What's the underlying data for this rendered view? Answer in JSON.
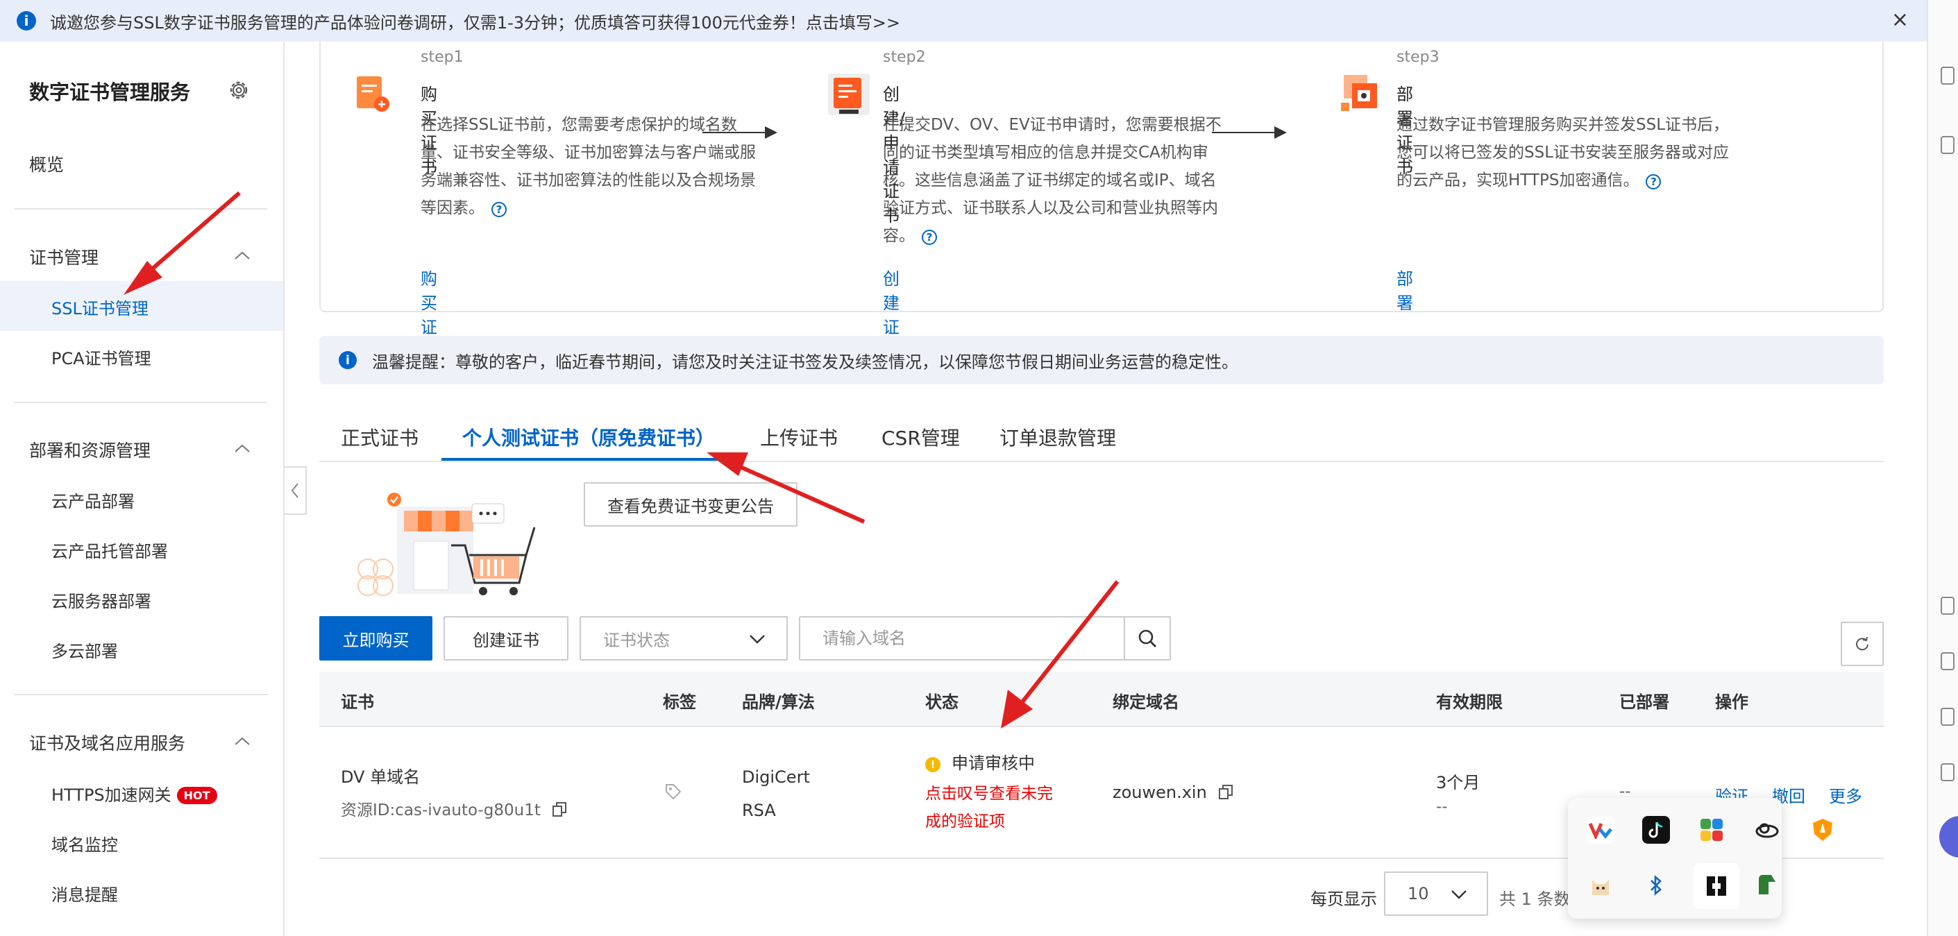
{
  "banner": {
    "text": "诚邀您参与SSL数字证书服务管理的产品体验问卷调研，仅需1-3分钟；优质填答可获得100元代金券！点击填写>>",
    "close": "×"
  },
  "sidebar": {
    "title": "数字证书管理服务",
    "overview": "概览",
    "groups": [
      {
        "label": "证书管理",
        "items": [
          "SSL证书管理",
          "PCA证书管理"
        ]
      },
      {
        "label": "部署和资源管理",
        "items": [
          "云产品部署",
          "云产品托管部署",
          "云服务器部署",
          "多云部署"
        ]
      },
      {
        "label": "证书及域名应用服务",
        "items": [
          "HTTPS加速网关",
          "域名监控",
          "消息提醒"
        ]
      }
    ],
    "hot_badge": "HOT"
  },
  "steps": [
    {
      "label": "step1",
      "title": "购买证书",
      "desc": "在选择SSL证书前，您需要考虑保护的域名数量、证书安全等级、证书加密算法与客户端或服务端兼容性、证书加密算法的性能以及合规场景等因素。",
      "link": "购买证书"
    },
    {
      "label": "step2",
      "title": "创建/申请证书",
      "desc": "在提交DV、OV、EV证书申请时，您需要根据不同的证书类型填写相应的信息并提交CA机构审核。这些信息涵盖了证书绑定的域名或IP、域名验证方式、证书联系人以及公司和营业执照等内容。",
      "link": "创建证书"
    },
    {
      "label": "step3",
      "title": "部署证书",
      "desc": "通过数字证书管理服务购买并签发SSL证书后，您可以将已签发的SSL证书安装至服务器或对应的云产品，实现HTTPS加密通信。",
      "link": "部署"
    }
  ],
  "notice": {
    "text": "温馨提醒：尊敬的客户，临近春节期间，请您及时关注证书签发及续签情况，以保障您节假日期间业务运营的稳定性。"
  },
  "tabs": [
    "正式证书",
    "个人测试证书（原免费证书）",
    "上传证书",
    "CSR管理",
    "订单退款管理"
  ],
  "active_tab": 1,
  "notice_button": "查看免费证书变更公告",
  "toolbar": {
    "buy": "立即购买",
    "create": "创建证书",
    "status_placeholder": "证书状态",
    "search_placeholder": "请输入域名"
  },
  "table": {
    "headers": [
      "证书",
      "标签",
      "品牌/算法",
      "状态",
      "绑定域名",
      "有效期限",
      "已部署",
      "操作"
    ],
    "rows": [
      {
        "name": "DV 单域名",
        "resource_id": "资源ID:cas-ivauto-g80u1t",
        "brand": "DigiCert",
        "algorithm": "RSA",
        "status": "申请审核中",
        "status_hint_1": "点击叹号查看未完",
        "status_hint_2": "成的验证项",
        "domain": "zouwen.xin",
        "validity": "3个月",
        "validity_sub": "--",
        "deployed": "--",
        "actions": [
          "验证",
          "撤回",
          "更多"
        ]
      }
    ]
  },
  "pagination": {
    "label": "每页显示",
    "page_size": "10",
    "total": "共 1 条数"
  },
  "colors": {
    "primary": "#0064c8",
    "warning": "#f5b800",
    "danger": "#e60012"
  }
}
